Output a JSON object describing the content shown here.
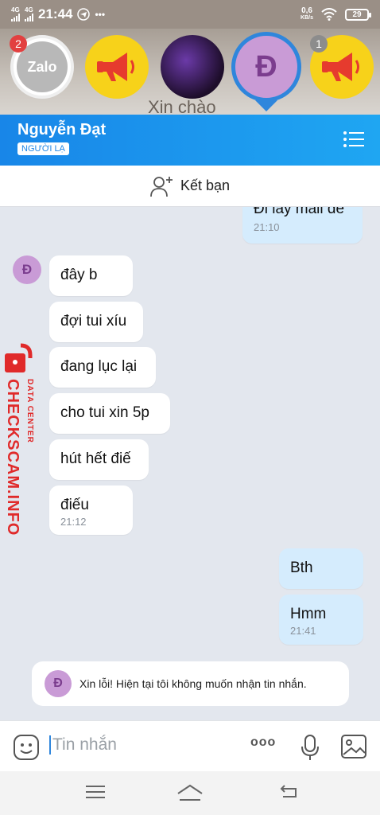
{
  "status_bar": {
    "net1": "4G",
    "net2": "4G",
    "time": "21:44",
    "more": "•••",
    "speed_value": "0,6",
    "speed_unit": "KB/s",
    "battery": "29"
  },
  "bubble_heads": {
    "zalo_label": "Zalo",
    "zalo_badge": "2",
    "active_initial": "Đ",
    "last_badge": "1",
    "background_text": "Xin chào"
  },
  "header": {
    "name": "Nguyễn Đạt",
    "tag": "NGƯỜI LẠ"
  },
  "add_friend": {
    "label": "Kết bạn"
  },
  "messages": [
    {
      "side": "out",
      "text": "Đi lấy mail để",
      "time": "21:10"
    },
    {
      "side": "in",
      "text": "đây b"
    },
    {
      "side": "in",
      "text": "đợi tui xíu"
    },
    {
      "side": "in",
      "text": "đang lục lại"
    },
    {
      "side": "in",
      "text": "cho tui xin 5p"
    },
    {
      "side": "in",
      "text": "hút hết điế"
    },
    {
      "side": "in",
      "text": "điếu",
      "time": "21:12"
    },
    {
      "side": "out",
      "text": "Bth"
    },
    {
      "side": "out",
      "text": "Hmm",
      "time": "21:41"
    }
  ],
  "sender_initial": "Đ",
  "notice": {
    "initial": "Đ",
    "text": "Xin lỗi! Hiện tại tôi không muốn nhận tin nhắn."
  },
  "watermark": {
    "main": "CHECKSCAM.INFO",
    "sub": "DATA CENTER"
  },
  "composer": {
    "placeholder": "Tin nhắn",
    "more": "ooo"
  },
  "colors": {
    "header_blue": "#1886e8",
    "outgoing_bubble": "#d5ecfd",
    "incoming_bubble": "#ffffff",
    "avatar_purple": "#c99bd6",
    "badge_red": "#e24040",
    "watermark_red": "#e02a2a"
  },
  "icons": [
    "signal-icon",
    "telegram-icon",
    "wifi-icon",
    "battery-icon",
    "megaphone-icon",
    "menu-list-icon",
    "add-friend-icon",
    "sticker-icon",
    "mic-icon",
    "image-icon",
    "lock-icon",
    "nav-menu-icon",
    "nav-home-icon",
    "nav-back-icon"
  ]
}
